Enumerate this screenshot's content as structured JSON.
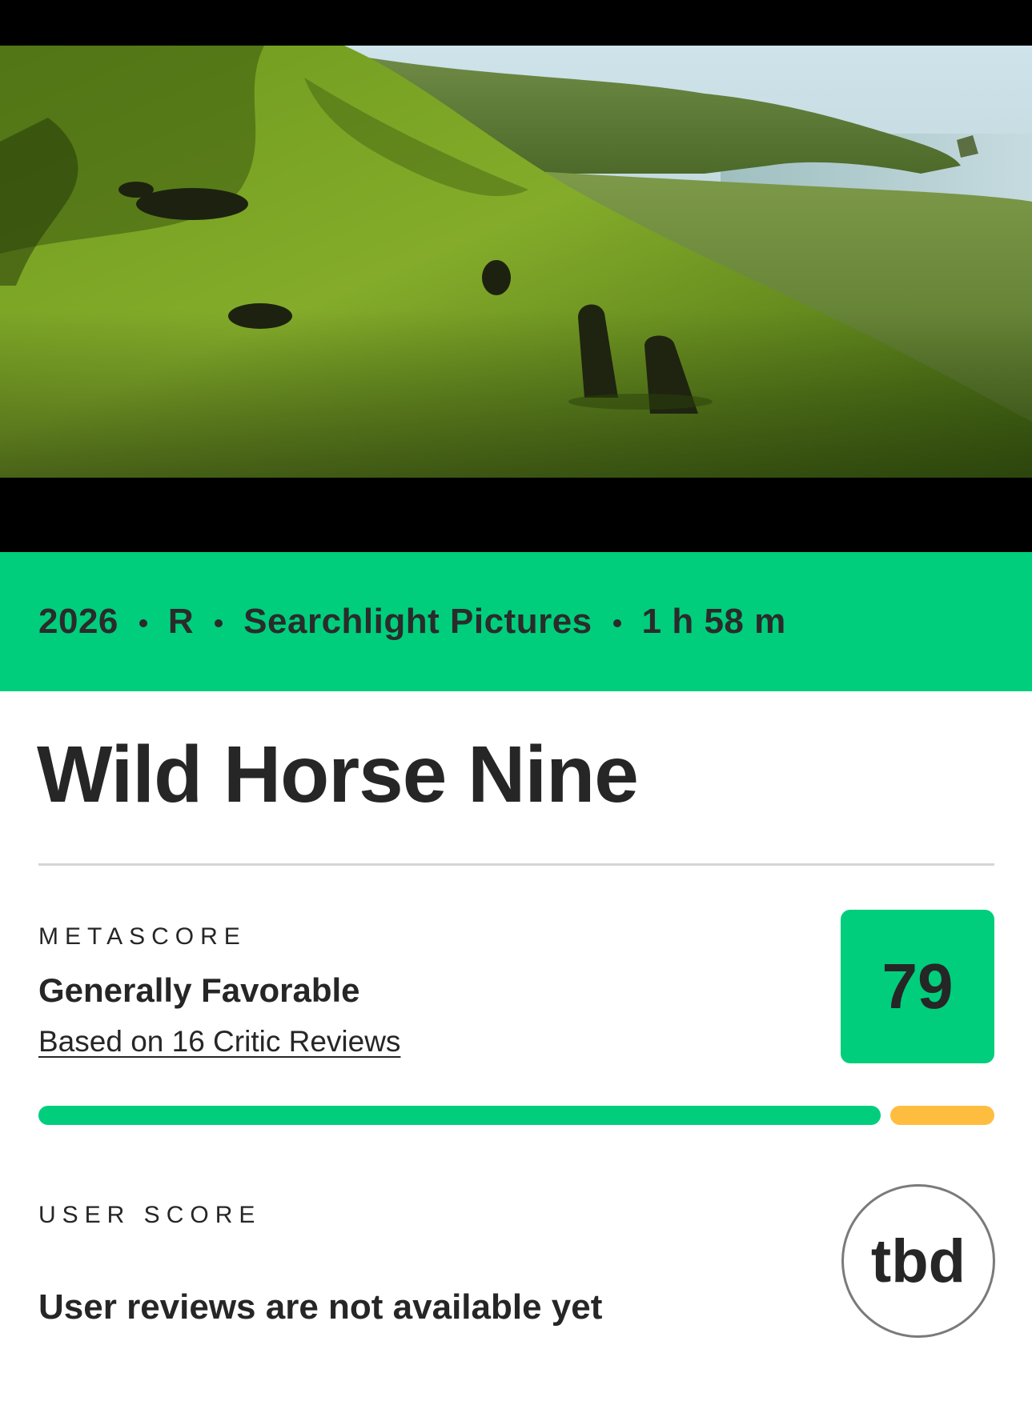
{
  "hero": {
    "media": "video-still",
    "description_icon": "landscape-icon"
  },
  "meta": {
    "year": "2026",
    "rating": "R",
    "studio": "Searchlight Pictures",
    "runtime": "1 h 58 m"
  },
  "title": "Wild Horse Nine",
  "metascore": {
    "label": "METASCORE",
    "verdict": "Generally Favorable",
    "reviews_link": "Based on 16 Critic Reviews",
    "score": "79",
    "score_color": "#00ce7c",
    "distribution": {
      "positive_fraction": 0.89,
      "mixed_fraction": 0.11,
      "positive_color": "#00ce7c",
      "mixed_color": "#ffbd3f"
    }
  },
  "userscore": {
    "label": "USER SCORE",
    "note": "User reviews are not available yet",
    "score": "tbd"
  },
  "colors": {
    "accent": "#00ce7c",
    "text": "#262626",
    "divider": "#d5d5d5"
  }
}
